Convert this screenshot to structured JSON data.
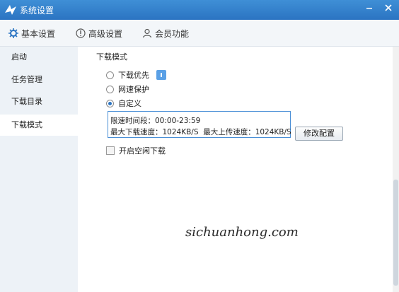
{
  "window": {
    "title": "系统设置"
  },
  "tabs": [
    {
      "label": "基本设置",
      "icon": "gear-icon"
    },
    {
      "label": "高级设置",
      "icon": "info-circle-icon"
    },
    {
      "label": "会员功能",
      "icon": "user-icon"
    }
  ],
  "sidebar": {
    "items": [
      {
        "label": "启动"
      },
      {
        "label": "任务管理"
      },
      {
        "label": "下载目录"
      },
      {
        "label": "下载模式",
        "active": true
      }
    ]
  },
  "main": {
    "section_title": "下载模式",
    "options": [
      {
        "label": "下载优先",
        "checked": false
      },
      {
        "label": "网速保护",
        "checked": false
      },
      {
        "label": "自定义",
        "checked": true
      }
    ],
    "info": {
      "line1": "限速时间段：00:00-23:59",
      "line2": "最大下载速度：1024KB/S  最大上传速度：1024KB/S"
    },
    "modify_button": "修改配置",
    "idle_download": {
      "label": "开启空闲下载",
      "checked": false
    }
  },
  "watermark": "sichuanhong.com",
  "colors": {
    "titlebar": "#2b74c2",
    "sidebar": "#edf2f7",
    "accent": "#4a8fd6"
  }
}
